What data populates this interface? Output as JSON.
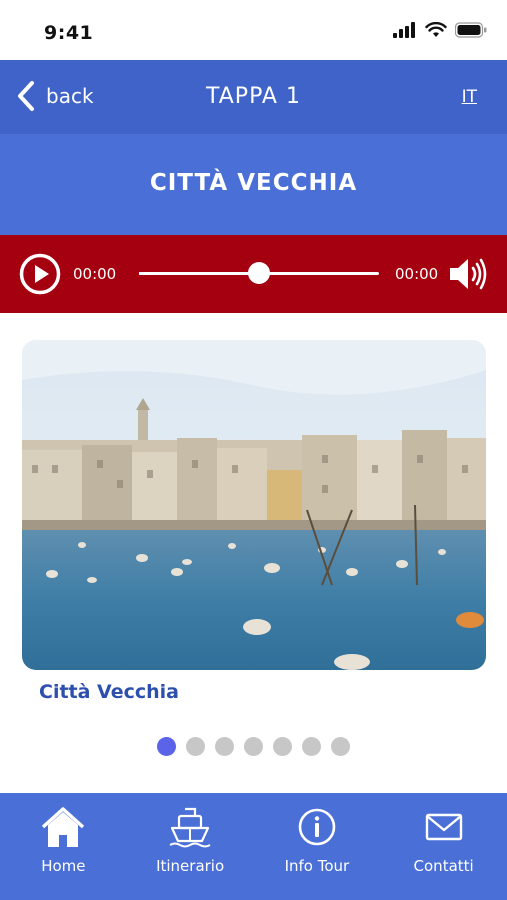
{
  "status_bar": {
    "time": "9:41"
  },
  "navbar": {
    "back_label": "back",
    "title": "TAPPA 1",
    "language": "IT"
  },
  "banner": {
    "title": "CITTÀ VECCHIA"
  },
  "player": {
    "current_time": "00:00",
    "total_time": "00:00",
    "progress": 0.5
  },
  "gallery": {
    "caption": "Città Vecchia",
    "page_count": 7,
    "active_index": 0
  },
  "tabs": [
    {
      "label": "Home",
      "icon": "home-icon"
    },
    {
      "label": "Itinerario",
      "icon": "ship-icon"
    },
    {
      "label": "Info Tour",
      "icon": "info-icon"
    },
    {
      "label": "Contatti",
      "icon": "mail-icon"
    }
  ],
  "colors": {
    "nav": "#3f63c8",
    "banner": "#4a6fd6",
    "player": "#a50010",
    "caption": "#2d4fae",
    "dot_active": "#5b63e8",
    "dot_inactive": "#c7c7c7"
  }
}
